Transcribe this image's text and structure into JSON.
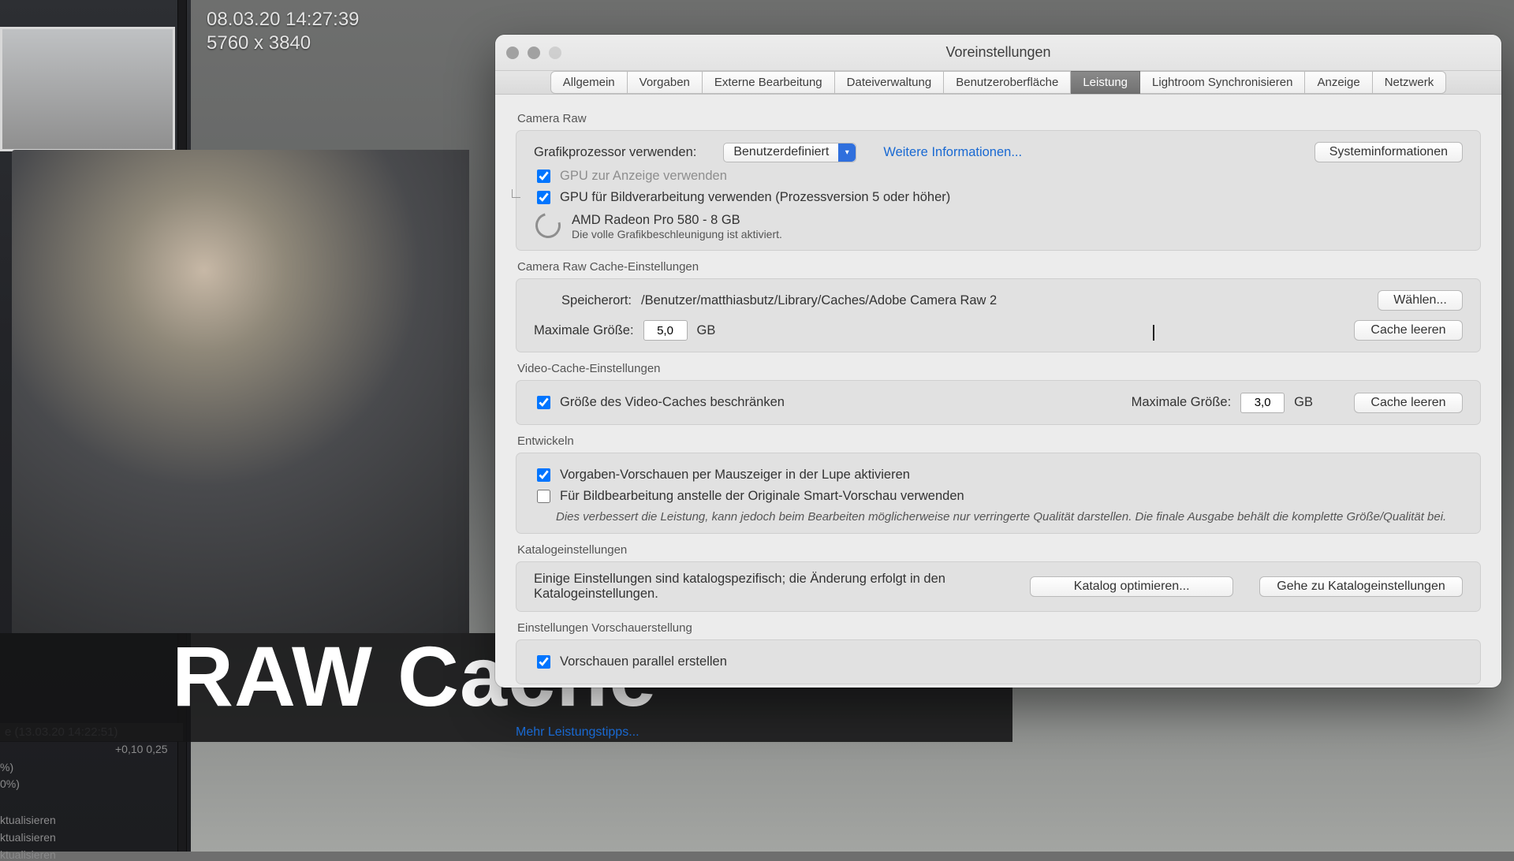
{
  "background": {
    "timestamp": "08.03.20 14:27:39",
    "resolution": "5760 x 3840",
    "history_header": "e (13.03.20 14:22:51)",
    "history_vals": "+0,10    0,25",
    "pct1": "%)",
    "pct2": "0%)",
    "sync1": "ktualisieren",
    "sync2": "ktualisieren",
    "sync3": "ktualisieren"
  },
  "banner": {
    "text": "RAW Cache"
  },
  "prefs": {
    "window_title": "Voreinstellungen",
    "tabs": [
      "Allgemein",
      "Vorgaben",
      "Externe Bearbeitung",
      "Dateiverwaltung",
      "Benutzeroberfläche",
      "Leistung",
      "Lightroom Synchronisieren",
      "Anzeige",
      "Netzwerk"
    ],
    "active_tab_index": 5,
    "camera_raw": {
      "title": "Camera Raw",
      "gpu_label": "Grafikprozessor verwenden:",
      "gpu_select": "Benutzerdefiniert",
      "more_info": "Weitere Informationen...",
      "sysinfo_btn": "Systeminformationen",
      "ck_display": "GPU zur Anzeige verwenden",
      "ck_process": "GPU für Bildverarbeitung verwenden (Prozessversion 5 oder höher)",
      "gpu_name": "AMD Radeon Pro 580 - 8 GB",
      "gpu_status": "Die volle Grafikbeschleunigung ist aktiviert."
    },
    "raw_cache": {
      "title": "Camera Raw Cache-Einstellungen",
      "loc_label": "Speicherort:",
      "loc_value": "/Benutzer/matthiasbutz/Library/Caches/Adobe Camera Raw 2",
      "choose_btn": "Wählen...",
      "max_label": "Maximale Größe:",
      "max_value": "5,0",
      "unit": "GB",
      "clear_btn": "Cache leeren"
    },
    "video_cache": {
      "title": "Video-Cache-Einstellungen",
      "limit_ck": "Größe des Video-Caches beschränken",
      "max_label": "Maximale Größe:",
      "max_value": "3,0",
      "unit": "GB",
      "clear_btn": "Cache leeren"
    },
    "develop": {
      "title": "Entwickeln",
      "ck_hover": "Vorgaben-Vorschauen per Mauszeiger in der Lupe aktivieren",
      "ck_smart": "Für Bildbearbeitung anstelle der Originale Smart-Vorschau verwenden",
      "note": "Dies verbessert die Leistung, kann jedoch beim Bearbeiten möglicherweise nur verringerte Qualität darstellen. Die finale Ausgabe behält die komplette Größe/Qualität bei."
    },
    "catalog": {
      "title": "Katalogeinstellungen",
      "text": "Einige Einstellungen sind katalogspezifisch; die Änderung erfolgt in den Katalogeinstellungen.",
      "optimize_btn": "Katalog optimieren...",
      "goto_btn": "Gehe zu Katalogeinstellungen"
    },
    "previews": {
      "title": "Einstellungen Vorschauerstellung",
      "ck_parallel": "Vorschauen parallel erstellen"
    },
    "more_tips": "Mehr Leistungstipps..."
  }
}
